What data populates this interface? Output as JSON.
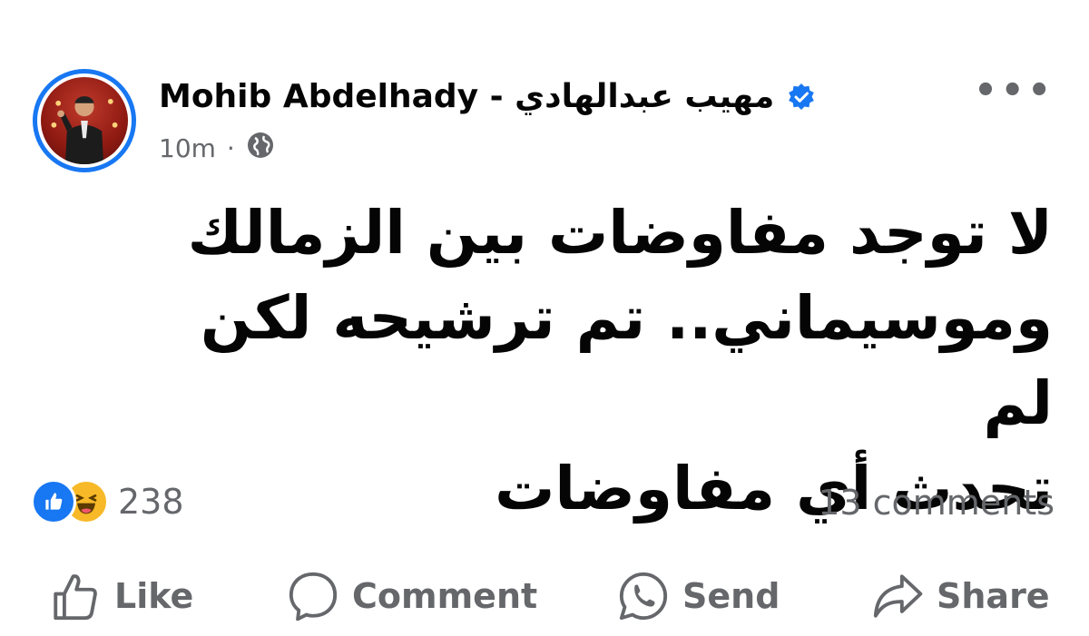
{
  "post": {
    "author_name": "Mohib Abdelhady - مهيب عبدالهادي",
    "timestamp": "10m",
    "separator": "·",
    "privacy_icon": "globe-icon",
    "more_label": "•••",
    "text_lines": [
      "لا توجد مفاوضات بين الزمالك",
      "وموسيماني.. تم ترشيحه لكن لم",
      "تحدث أي مفاوضات"
    ]
  },
  "stats": {
    "reaction_count": "238",
    "comments_label": "13 comments"
  },
  "actions": {
    "like": "Like",
    "comment": "Comment",
    "send": "Send",
    "share": "Share"
  },
  "colors": {
    "accent": "#1877f2",
    "muted": "#65676b",
    "haha": "#f7b928"
  }
}
